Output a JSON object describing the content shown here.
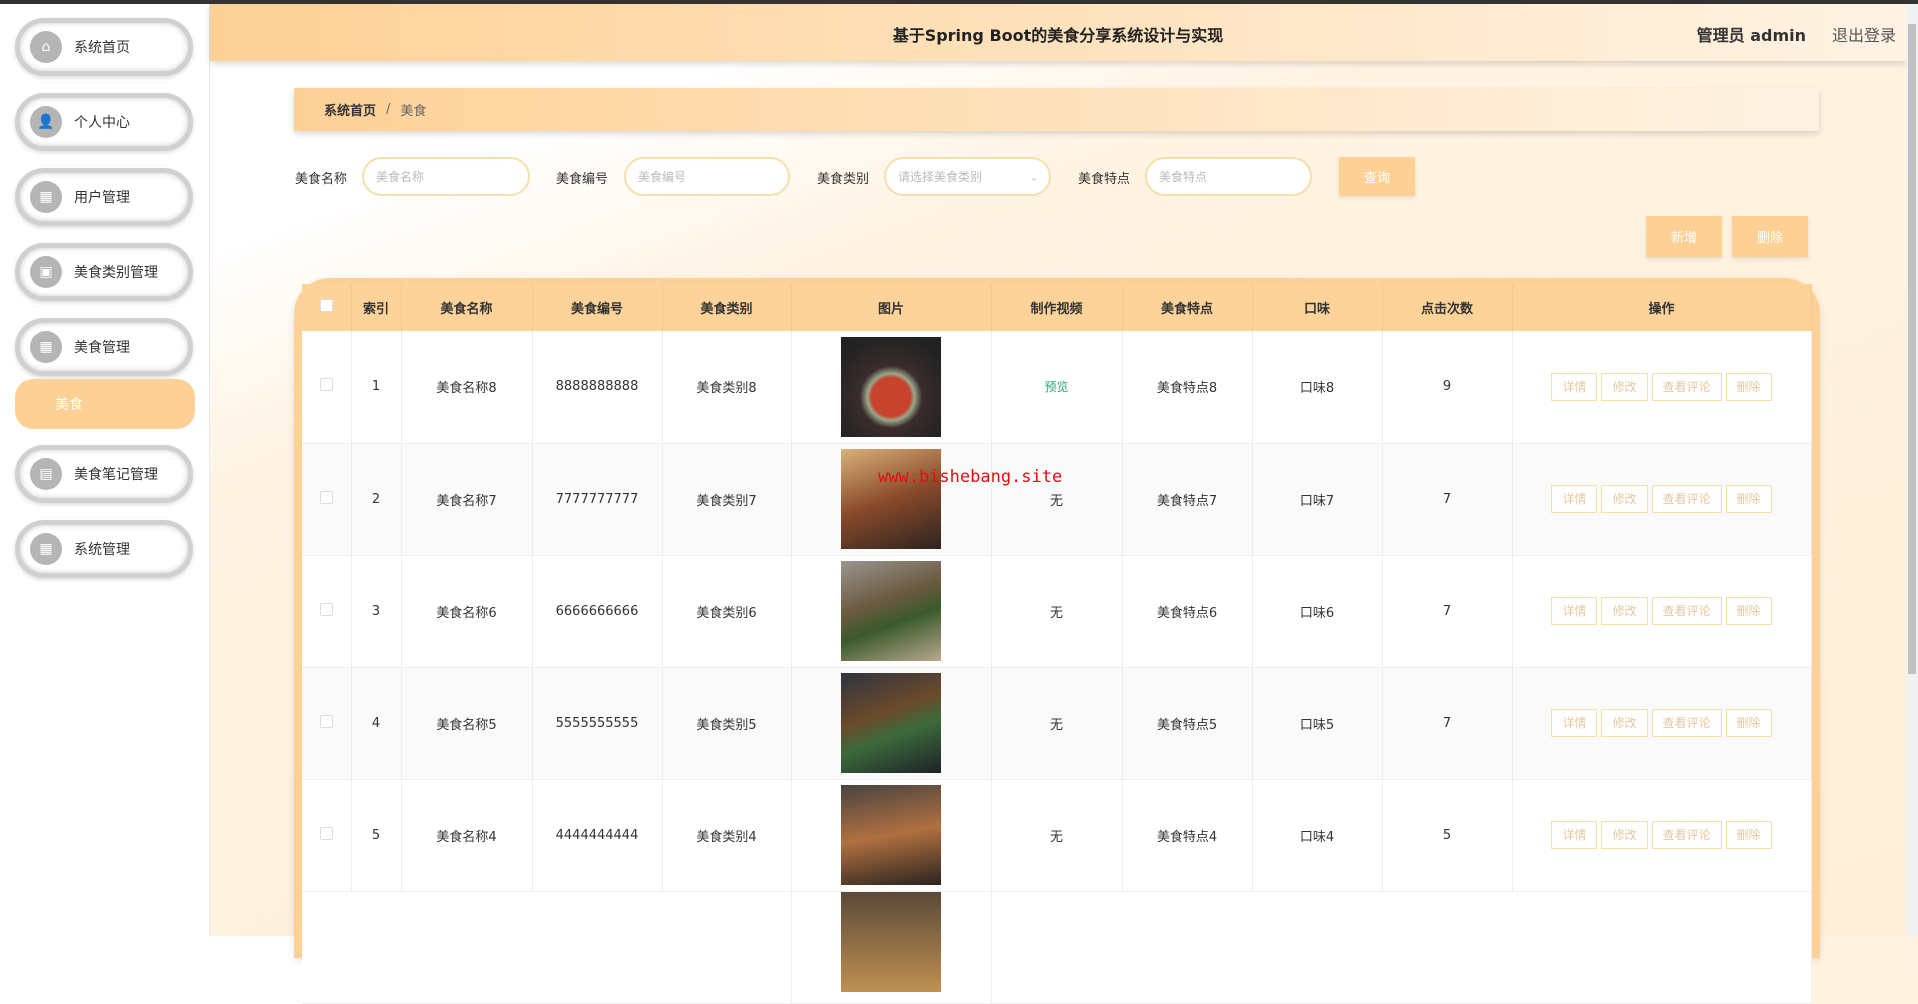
{
  "header": {
    "title": "基于Spring Boot的美食分享系统设计与实现",
    "user": "管理员 admin",
    "logout": "退出登录"
  },
  "sidebar": {
    "items": [
      {
        "label": "系统首页",
        "icon": "home-icon",
        "glyph": "⌂"
      },
      {
        "label": "个人中心",
        "icon": "user-icon",
        "glyph": "👤"
      },
      {
        "label": "用户管理",
        "icon": "grid-icon",
        "glyph": "▦"
      },
      {
        "label": "美食类别管理",
        "icon": "briefcase-icon",
        "glyph": "▣"
      },
      {
        "label": "美食管理",
        "icon": "grid-icon",
        "glyph": "▦"
      },
      {
        "label": "美食笔记管理",
        "icon": "chat-icon",
        "glyph": "▤"
      },
      {
        "label": "系统管理",
        "icon": "grid-icon",
        "glyph": "▦"
      }
    ],
    "sub_active": "美食"
  },
  "breadcrumb": {
    "home": "系统首页",
    "sep": "/",
    "current": "美食"
  },
  "search": {
    "name_label": "美食名称",
    "name_ph": "美食名称",
    "code_label": "美食编号",
    "code_ph": "美食编号",
    "cat_label": "美食类别",
    "cat_ph": "请选择美食类别",
    "feat_label": "美食特点",
    "feat_ph": "美食特点",
    "query": "查询"
  },
  "actions": {
    "add": "新增",
    "delete": "删除"
  },
  "table": {
    "headers": [
      "索引",
      "美食名称",
      "美食编号",
      "美食类别",
      "图片",
      "制作视频",
      "美食特点",
      "口味",
      "点击次数",
      "操作"
    ],
    "op_labels": [
      "详情",
      "修改",
      "查看评论",
      "删除"
    ],
    "rows": [
      {
        "idx": "1",
        "name": "美食名称8",
        "code": "8888888888",
        "cat": "美食类别8",
        "video": "预览",
        "feat": "美食特点8",
        "taste": "口味8",
        "clicks": "9"
      },
      {
        "idx": "2",
        "name": "美食名称7",
        "code": "7777777777",
        "cat": "美食类别7",
        "video": "无",
        "feat": "美食特点7",
        "taste": "口味7",
        "clicks": "7"
      },
      {
        "idx": "3",
        "name": "美食名称6",
        "code": "6666666666",
        "cat": "美食类别6",
        "video": "无",
        "feat": "美食特点6",
        "taste": "口味6",
        "clicks": "7"
      },
      {
        "idx": "4",
        "name": "美食名称5",
        "code": "5555555555",
        "cat": "美食类别5",
        "video": "无",
        "feat": "美食特点5",
        "taste": "口味5",
        "clicks": "7"
      },
      {
        "idx": "5",
        "name": "美食名称4",
        "code": "4444444444",
        "cat": "美食类别4",
        "video": "无",
        "feat": "美食特点4",
        "taste": "口味4",
        "clicks": "5"
      }
    ]
  },
  "watermark": "www.bishebang.site",
  "colors": {
    "accent": "#fdd196",
    "preview": "#2aa876"
  }
}
